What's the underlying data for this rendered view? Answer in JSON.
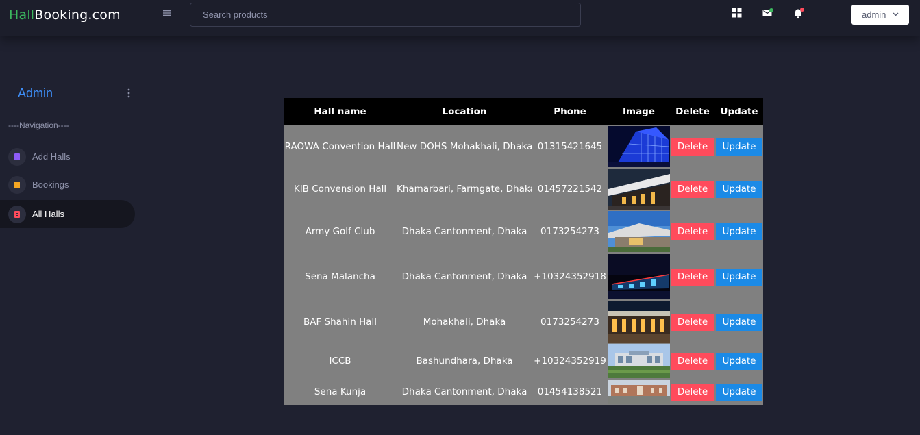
{
  "brand": {
    "part1": "Hall",
    "part2": "Booking.com"
  },
  "topbar": {
    "search_placeholder": "Search products",
    "user_label": "admin",
    "icons": [
      "menu-icon",
      "apps-grid-icon",
      "mail-icon",
      "bell-icon",
      "chevron-down-icon"
    ],
    "mail_dot_color": "#3bb75e",
    "bell_dot_color": "#ff4b5c"
  },
  "sidebar": {
    "title": "Admin",
    "caption": "----Navigation----",
    "items": [
      {
        "label": "Add Halls",
        "icon": "document-icon",
        "icon_color": "#8e5cf7",
        "active": false
      },
      {
        "label": "Bookings",
        "icon": "document-icon",
        "icon_color": "#f5a623",
        "active": false
      },
      {
        "label": "All Halls",
        "icon": "document-icon",
        "icon_color": "#ff4b5c",
        "active": true
      }
    ]
  },
  "table": {
    "headers": [
      "Hall name",
      "Location",
      "Phone",
      "Image",
      "Delete",
      "Update"
    ],
    "delete_label": "Delete",
    "update_label": "Update",
    "rows": [
      {
        "name": "RAOWA Convention Hall",
        "location": "New DOHS Mohakhali, Dhaka",
        "phone": "01315421645",
        "image": "blue-glass-building-photo"
      },
      {
        "name": "KIB Convension Hall",
        "location": "Khamarbari, Farmgate, Dhaka",
        "phone": "01457221542",
        "image": "night-roof-building-photo"
      },
      {
        "name": "Army Golf Club",
        "location": "Dhaka Cantonment, Dhaka",
        "phone": "0173254273",
        "image": "clubhouse-daytime-photo"
      },
      {
        "name": "Sena Malancha",
        "location": "Dhaka Cantonment, Dhaka",
        "phone": "+10324352918",
        "image": "night-lit-hall-photo"
      },
      {
        "name": "BAF Shahin Hall",
        "location": "Mohakhali, Dhaka",
        "phone": "0173254273",
        "image": "lit-facade-photo"
      },
      {
        "name": "ICCB",
        "location": "Bashundhara, Dhaka",
        "phone": "+10324352919",
        "image": "convention-center-photo"
      },
      {
        "name": "Sena Kunja",
        "location": "Dhaka Cantonment, Dhaka",
        "phone": "01454138521",
        "image": "complex-entrance-photo"
      }
    ]
  }
}
